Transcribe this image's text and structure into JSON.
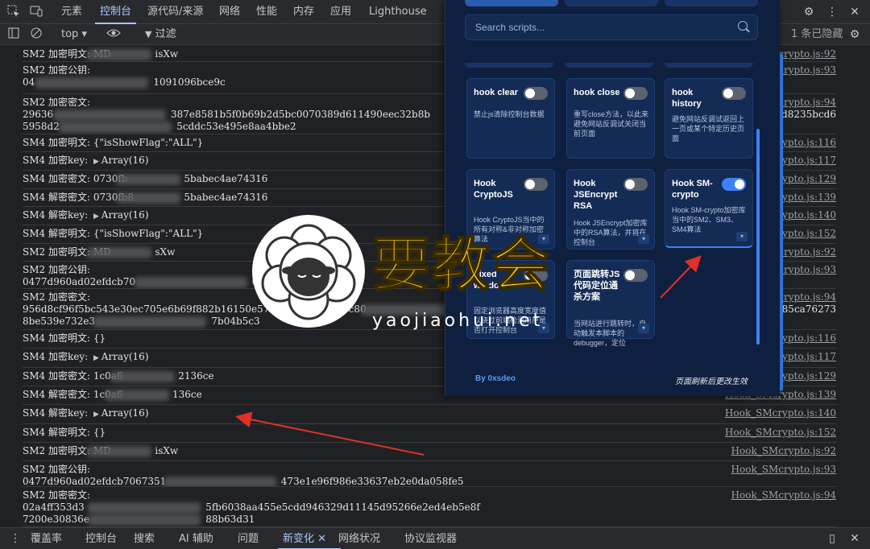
{
  "devtools": {
    "tabs": [
      "元素",
      "控制台",
      "源代码/来源",
      "网络",
      "性能",
      "内存",
      "应用",
      "Lighthouse"
    ],
    "active_tab": "控制台",
    "context": "top",
    "filter_placeholder": "过滤",
    "hidden_count": "1 条已隐藏",
    "icons": [
      "inspect-icon",
      "device-icon",
      "sidebar-icon",
      "clear-icon",
      "eye-icon",
      "filter-icon",
      "settings-icon",
      "more-icon",
      "close-icon"
    ]
  },
  "console_rows": [
    {
      "text": "SM2 加密明文: MD",
      "tail": "isXw",
      "source": "Hook_SMcrypto.js:92"
    },
    {
      "text": "SM2 加密公钥:",
      "line2": "04",
      "line2_tail": "1091096bce9c",
      "source": "Hook_SMcrypto.js:93"
    },
    {
      "text": "SM2 加密密文:",
      "line2": "29636",
      "line2_tail": "387e8581b5f0b69b2d5bc0070389d611490eec32b8b",
      "line3": "5958d2",
      "line3_tail": "5cddc53e495e8aa4bbe2",
      "source": "Hook_SMcrypto.js:94",
      "source_tail": "d3d8235bcd6"
    },
    {
      "text": "SM4 加密明文: {\"isShowFlag\":\"ALL\"}",
      "source": "Hook_SMcrypto.js:116"
    },
    {
      "text": "SM4 加密key:",
      "array": "Array(16)",
      "source": "Hook_SMcrypto.js:117"
    },
    {
      "text": "SM4 加密密文:  0730fb",
      "tail": "5babec4ae74316",
      "source": "Hook_SMcrypto.js:129"
    },
    {
      "text": "SM4 解密密文: 0730fb8",
      "tail": "5babec4ae74316",
      "source": "Hook_SMcrypto.js:139"
    },
    {
      "text": "SM4 解密key:",
      "array": "Array(16)",
      "source": "Hook_SMcrypto.js:140"
    },
    {
      "text": "SM4 解密明文:  {\"isShowFlag\":\"ALL\"}",
      "source": "Hook_SMcrypto.js:152"
    },
    {
      "text": "SM2 加密明文: MD",
      "tail": "sXw",
      "source": "Hook_SMcrypto.js:92"
    },
    {
      "text": "SM2 加密公钥:",
      "line2": "0477d960ad02efdcb70",
      "line2_tail": "0a109",
      "source": "Hook_SMcrypto.js:93"
    },
    {
      "text": "SM2 加密密文:",
      "line2": "956d8cf96f5bc543e30ec705e6b69f882b16150e578507413e2d4e7c80",
      "line2_tail": "6cdb02590b6cfe13a6165",
      "line3": "8be539e732e3",
      "line3_tail": "7b04b5c3",
      "source": "Hook_SMcrypto.js:94",
      "source_tail": "cd85ca76273"
    },
    {
      "text": "SM4 加密明文: {}",
      "source": "Hook_SMcrypto.js:116"
    },
    {
      "text": "SM4 加密key:",
      "array": "Array(16)",
      "source": "Hook_SMcrypto.js:117"
    },
    {
      "text": "SM4 加密密文:  1c0a6",
      "tail": "2136ce",
      "source": "Hook_SMcrypto.js:129"
    },
    {
      "text": "SM4 解密密文: 1c0a6",
      "tail": "136ce",
      "source": "Hook_SMcrypto.js:139"
    },
    {
      "text": "SM4 解密key:",
      "array": "Array(16)",
      "source": "Hook_SMcrypto.js:140"
    },
    {
      "text": "SM4 解密明文:  {}",
      "source": "Hook_SMcrypto.js:152"
    },
    {
      "text": "SM2 加密明文: MD",
      "tail": "isXw",
      "source": "Hook_SMcrypto.js:92"
    },
    {
      "text": "SM2 加密公钥:",
      "line2": "0477d960ad02efdcb7067351",
      "line2_tail": "473e1e96f986e33637eb2e0da058fe5",
      "source": "Hook_SMcrypto.js:93"
    },
    {
      "text": "SM2 加密密文:",
      "line2": "02a4ff353d3",
      "line2_tail": "5fb6038aa455e5cdd946329d11145d95266e2ed4eb5e8f",
      "line3": "7200e30836e",
      "line3_tail": "88b63d31",
      "source": "Hook_SMcrypto.js:94"
    }
  ],
  "popup": {
    "search_placeholder": "Search scripts...",
    "cards": [
      {
        "title": "hook clear",
        "desc": "禁止js清除控制台数据",
        "on": false
      },
      {
        "title": "hook close",
        "desc": "重写close方法，以此来避免网站反调试关闭当前页面",
        "on": false
      },
      {
        "title": "hook history",
        "desc": "避免网站反调试返回上一页或某个特定历史页面",
        "on": false
      },
      {
        "title": "Hook CryptoJS",
        "desc": "Hook CryptoJS当中的所有对称&非对称加密算法",
        "on": false
      },
      {
        "title": "Hook JSEncrypt RSA",
        "desc": "Hook JSEncrypt加密库中的RSA算法，并将在控制台",
        "on": false
      },
      {
        "title": "Hook SM-crypto",
        "desc": "Hook SM-crypto加密库当中的SM2、SM3、SM4算法",
        "on": true
      },
      {
        "title": "Fixed window",
        "desc": "固定浏览器高度宽度值以绕过前端检测用户是否打开控制台",
        "on": false
      },
      {
        "title": "页面跳转JS代码定位通杀方案",
        "desc": "当网站进行跳转时，自动触发本脚本的debugger，定位",
        "on": false
      }
    ],
    "footer_left": "By 0xsdeo",
    "footer_right": "页面刷新后更改生效"
  },
  "drawer_tabs": [
    "覆盖率",
    "控制台",
    "搜索",
    "AI 辅助",
    "问题",
    "新变化",
    "网络状况",
    "协议监视器"
  ],
  "drawer_active": "新变化",
  "watermark": {
    "text": "要教会",
    "url": "yaojiaohui.net"
  },
  "colors": {
    "accent": "#a8c7fa",
    "popup_bg": "#0f1f3f",
    "toggle_on": "#3b82f6",
    "watermark": "#ffd814",
    "arrow": "#e0302a"
  }
}
